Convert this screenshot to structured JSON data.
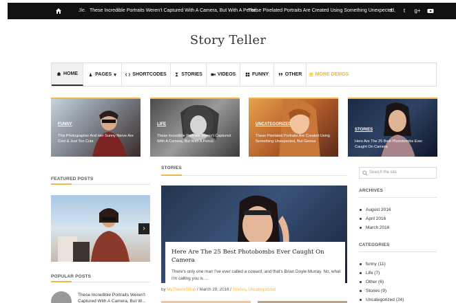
{
  "topbar": {
    "ticker_label": "Jle.",
    "ticker_items": [
      "These Incredible Portraits Weren't Captured With A Camera, But With A Pencil.",
      "These Pixelated Portraits Are Created Using Something Unexpected,"
    ],
    "social": [
      "f",
      "t",
      "g+",
      "yt"
    ]
  },
  "site": {
    "title": "Story Teller"
  },
  "nav": {
    "items": [
      {
        "label": "HOME",
        "icon": "home-icon"
      },
      {
        "label": "PAGES",
        "icon": "pages-icon"
      },
      {
        "label": "SHORTCODES",
        "icon": "code-icon"
      },
      {
        "label": "STORIES",
        "icon": "hourglass-icon"
      },
      {
        "label": "VIDEOS",
        "icon": "video-icon"
      },
      {
        "label": "FUNNY",
        "icon": "grid-icon"
      },
      {
        "label": "OTHER",
        "icon": "quote-icon"
      },
      {
        "label": "MORE DEMOS",
        "icon": "list-icon"
      }
    ],
    "special_color": "#f2b53c"
  },
  "featured": [
    {
      "category": "FUNNY",
      "title": "This Photographer And Her Sunny Nerve Are Cool & Just Too Cute"
    },
    {
      "category": "LIFE",
      "title": "These Incredible Portraits Weren't Captured With A Camera, But With A Pencil."
    },
    {
      "category": "UNCATEGORIZED",
      "title": "These Pixelated Portraits Are Created Using Something Unexpected, But Genius"
    },
    {
      "category": "STORIES",
      "title": "Here Are The 25 Best Photobombs Ever Caught On Camera"
    }
  ],
  "left": {
    "featured_heading": "FEATURED POSTS",
    "popular_heading": "POPULAR POSTS",
    "popular_item": "These Incredible Portraits Weren't Captured With A Camera, But W..."
  },
  "main": {
    "heading": "STORIES",
    "post_title": "Here Are The 25 Best Photobombs Ever Caught On Camera",
    "excerpt": "There's only one man I've ever called a coward, and that's Brian Doyle Murray. No, what I'm calling you is ...",
    "meta_by": "by",
    "meta_author": "MyThemeShop",
    "meta_date": "March 29, 2016",
    "meta_cats": [
      "Stories",
      "Uncategorized"
    ]
  },
  "sidebar": {
    "search_placeholder": "Search the site",
    "archives_heading": "ARCHIVES",
    "archives": [
      "August 2016",
      "April 2016",
      "March 2016"
    ],
    "categories_heading": "CATEGORIES",
    "categories": [
      "funny (11)",
      "Life (7)",
      "Other (6)",
      "Stories (9)",
      "Uncategorized (24)"
    ]
  },
  "colors": {
    "accent": "#f1b24a",
    "topbar": "#111111"
  }
}
